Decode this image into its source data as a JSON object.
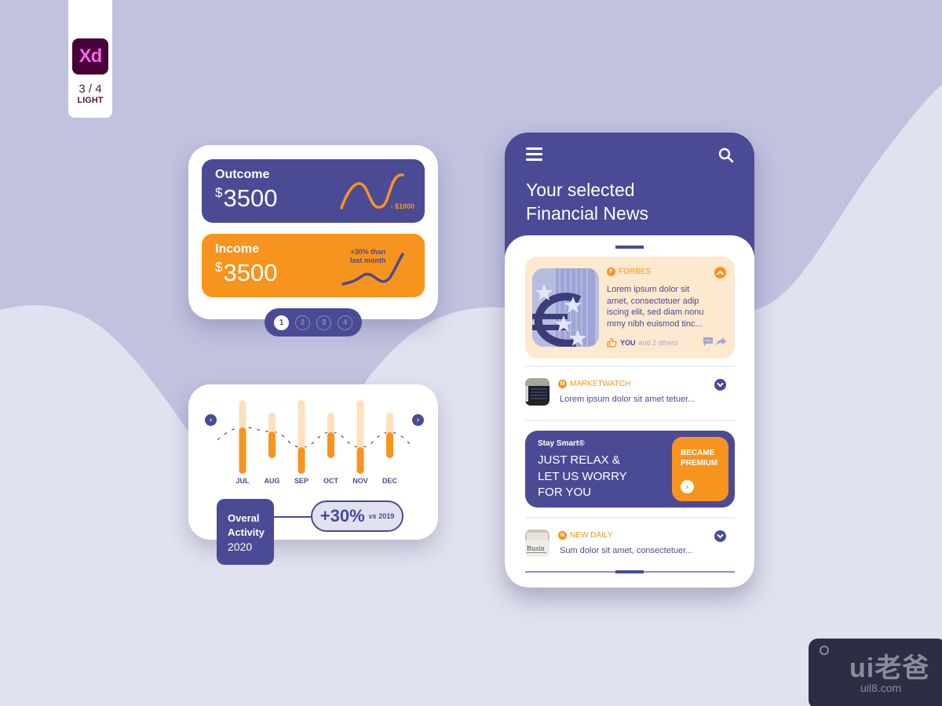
{
  "badge": {
    "app": "Xd",
    "page": "3 / 4",
    "mode": "LIGHT"
  },
  "colors": {
    "primary": "#4a4b94",
    "accent": "#f7941d",
    "accent_light": "#fde8d0",
    "background": "#c1c2df",
    "background_light": "#e1e2ef"
  },
  "cards": {
    "outcome": {
      "title": "Outcome",
      "currency": "$",
      "amount": "3500",
      "note": "- $1000"
    },
    "income": {
      "title": "Income",
      "currency": "$",
      "amount": "3500",
      "note_line1": "+30% than",
      "note_line2": "last month"
    },
    "pager": {
      "pages": [
        "1",
        "2",
        "3",
        "4"
      ],
      "active": 0
    }
  },
  "activity": {
    "prev_icon": "chevron-left-icon",
    "next_icon": "chevron-right-icon",
    "title_line1": "Overal",
    "title_line2": "Activity",
    "year": "2020",
    "growth": "+30%",
    "growth_vs": "vs",
    "growth_year": "2019"
  },
  "chart_data": {
    "type": "bar",
    "categories": [
      "JUL",
      "AUG",
      "SEP",
      "OCT",
      "NOV",
      "DEC"
    ],
    "series": [
      {
        "name": "capacity",
        "values": [
          100,
          80,
          100,
          84,
          100,
          84
        ]
      },
      {
        "name": "actual",
        "values": [
          63,
          46,
          36,
          45,
          36,
          45
        ]
      }
    ],
    "trend_line": "dashed",
    "ylim": [
      0,
      100
    ],
    "title": "",
    "xlabel": "",
    "ylabel": ""
  },
  "phone": {
    "title_line1": "Your selected",
    "title_line2": "Financial News",
    "menu_icon": "hamburger-menu-icon",
    "search_icon": "search-icon",
    "featured": {
      "source_badge": "F",
      "source": "FORBES",
      "text_lines": [
        "Lorem ipsum dolor sit",
        "amet, consectetuer adip",
        "iscing elit, sed diam nonu",
        "mmy nibh euismod tinc..."
      ],
      "likes_you": "YOU",
      "likes_others": "and 2 others"
    },
    "items": [
      {
        "source_badge": "M",
        "source": "MARKETWATCH",
        "text": "Lorem ipsum dolor sit amet tetuer..."
      },
      {
        "source_badge": "N",
        "source": "NEW DAILY",
        "text": "Sum dolor sit amet, consectetuer..."
      }
    ],
    "promo": {
      "brand": "Stay Smart®",
      "lines": [
        "JUST RELAX &",
        "LET US WORRY",
        "FOR YOU"
      ],
      "button_line1": "BECAME",
      "button_line2": "PREMIUM"
    }
  },
  "watermark": {
    "logo": "ui老爸",
    "url": "uil8.com"
  }
}
